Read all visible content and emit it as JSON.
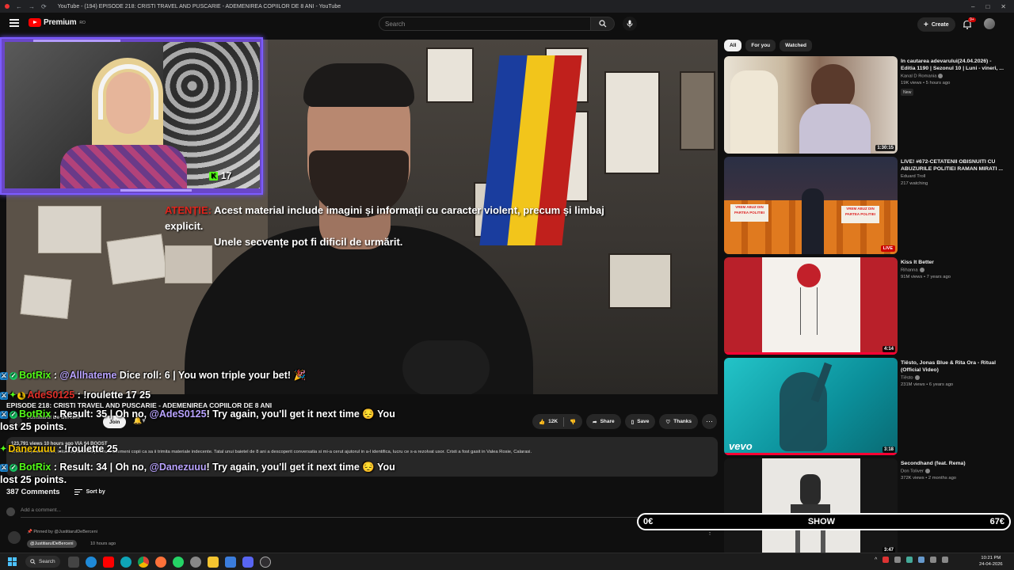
{
  "browser": {
    "tab_title": "YouTube - (194) EPISODE 218: CRISTI TRAVEL AND PUSCARIE - ADEMENIREA COPIILOR DE 8 ANI - YouTube"
  },
  "masthead": {
    "logo_text": "Premium",
    "logo_region": "RO",
    "search_placeholder": "Search",
    "create_label": "Create",
    "notifications_badge": "9+"
  },
  "player": {
    "warning_label": "ATENȚIE:",
    "warning_line1": "Acest material include imagini și informații cu caracter violent, precum și limbaj explicit.",
    "warning_line2": "Unele secvențe pot fi dificil de urmărit."
  },
  "webcam": {
    "viewer_count": "17",
    "platform_glyph": "K"
  },
  "chat": [
    {
      "nick": "BotRix",
      "sep": " : ",
      "mention": "@Allhateme",
      "text": " Dice roll: 6 | You won triple your bet! 🎉"
    },
    {
      "nick": "AdeS0125",
      "sep": " : ",
      "text": "!roulette 17 25"
    },
    {
      "nick": "BotRix",
      "sep": " : ",
      "pre": "Result: 35 | Oh no, ",
      "mention": "@AdeS0125",
      "text": "! Try again, you'll get it next time 😔 You lost 25 points."
    },
    {
      "nick": "Danezuuu",
      "sep": " : ",
      "text": "!roulette 25"
    },
    {
      "nick": "BotRix",
      "sep": " : ",
      "pre": "Result: 34 | Oh no, ",
      "mention": "@Danezuuu",
      "text": "! Try again, you'll get it next time 😔 You lost 25 points."
    }
  ],
  "video": {
    "title": "EPISODE 218: CRISTI TRAVEL AND PUSCARIE - ADEMENIREA COPIILOR DE 8 ANI",
    "channel": "Justitiarul De Berceni",
    "join_label": "Join",
    "likes": "12K",
    "share_label": "Share",
    "save_label": "Save",
    "thanks_label": "Thanks",
    "stats": "123,791 views  10 hours ago  VIA 64 BOOST",
    "description": "Cristi, un pedofil inrăit, folosea platforma pentru a ademeni copii ca sa ii trimita materiale indecente. Tatal unui baietel de 8 ani a descoperit conversatia si mi-a cerut ajutorul in a-l identifica, lucru ce s-a rezolvat usor. Cristi a fost gasit in Valea Rosie, Calarasi."
  },
  "comments": {
    "count": "387 Comments",
    "sort_label": "Sort by",
    "add_placeholder": "Add a comment...",
    "pinned_label": "Pinned by @JustitiarulDeBerceni",
    "pinned_author": "@JustitiarulDeBerceni",
    "pinned_time": "10 hours ago"
  },
  "sidebar": {
    "chips": [
      "All",
      "For you",
      "Watched"
    ],
    "items": [
      {
        "title": "In cautarea adevarului(24.04.2026) - Editia 1190 | Sezonul 10 | Luni - vineri, ...",
        "channel": "Kanal D Romania",
        "meta": "19K views • 5 hours ago",
        "badge": "New",
        "duration": "1:30:15"
      },
      {
        "title": "LIVE! #672-CETATENII OBISNUITI CU ABUZURILE POLITIEI RAMAN MIRATI ...",
        "channel": "Eduard Troll",
        "meta": "217 watching",
        "live": "LIVE"
      },
      {
        "title": "Kiss It Better",
        "channel": "Rihanna",
        "meta": "91M views • 7 years ago",
        "duration": "4:14"
      },
      {
        "title": "Tiësto, Jonas Blue & Rita Ora - Ritual (Official Video)",
        "channel": "Tiësto",
        "meta": "231M views • 6 years ago",
        "duration": "3:18"
      },
      {
        "title": "Secondhand (feat. Rema)",
        "channel": "Don Toliver",
        "meta": "372K views • 2 months ago",
        "duration": "3:47"
      }
    ],
    "thumb_caption_vevo": "vevo",
    "thumb_caption_protest": "VREM ABUZ DIN PARTEA POLITIEI"
  },
  "show_bar": {
    "left": "0€",
    "center": "SHOW",
    "right": "67€"
  },
  "taskbar": {
    "search_label": "Search",
    "time": "10:21 PM",
    "date": "24-04-2026"
  },
  "colors": {
    "yt_red": "#ff0000",
    "kick_green": "#53fc18",
    "cam_border": "#7c5cff",
    "warning_red": "#e0241c"
  }
}
